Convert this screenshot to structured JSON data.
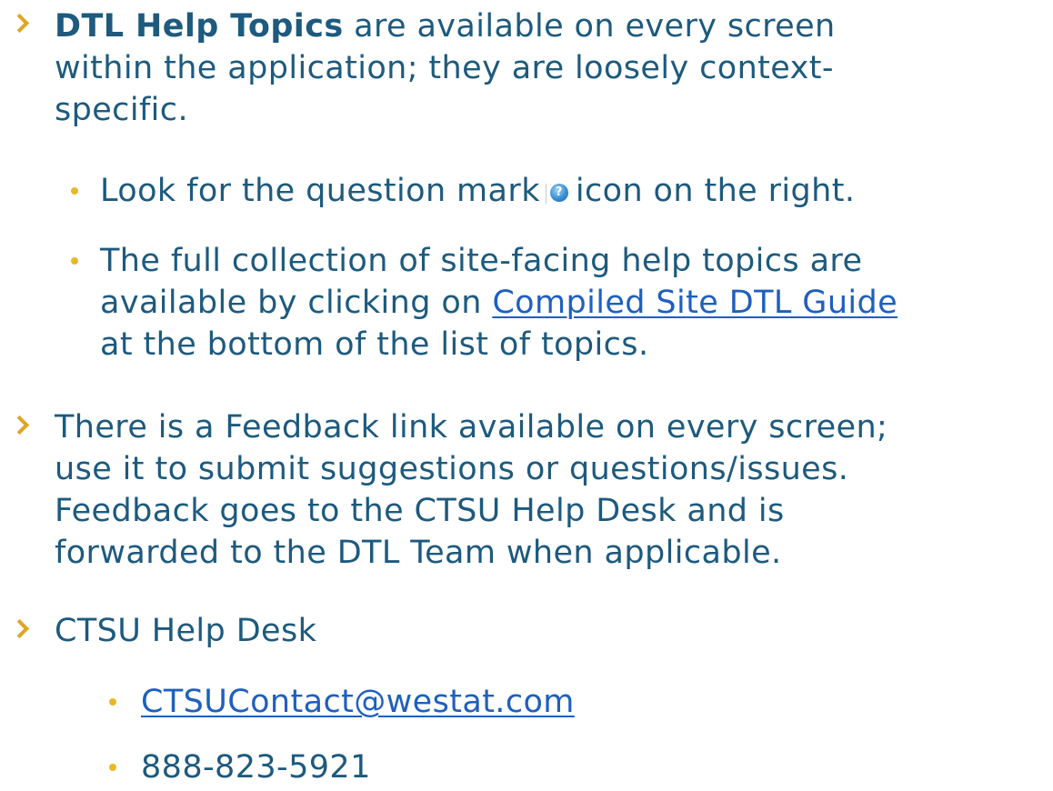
{
  "bullets": {
    "b1": {
      "bold": "DTL Help Topics",
      "line1_rest": " are available on every screen",
      "line2": "within the application; they are loosely context-",
      "line3": "specific."
    },
    "b1a": {
      "pre": "Look for the question mark",
      "icon": "question-mark-icon",
      "post": "icon on the right."
    },
    "b1b": {
      "line1": "The full collection of site-facing help topics are",
      "line2_pre": "available by clicking on ",
      "link": "Compiled Site DTL Guide",
      "line3": "at the bottom of the list of topics."
    },
    "b2": {
      "line1": "There is a Feedback link available on every screen;",
      "line2": "use it to submit suggestions or questions/issues.",
      "line3": "Feedback goes to the CTSU Help Desk and is",
      "line4": "forwarded to the DTL Team when applicable."
    },
    "b3": {
      "label": "CTSU Help Desk",
      "email": "CTSUContact@westat.com",
      "phone": "888-823-5921"
    }
  },
  "colors": {
    "text": "#1d5a7e",
    "chevron": "#e0a526",
    "dot": "#e8b82a",
    "link": "#1f5fbf"
  }
}
